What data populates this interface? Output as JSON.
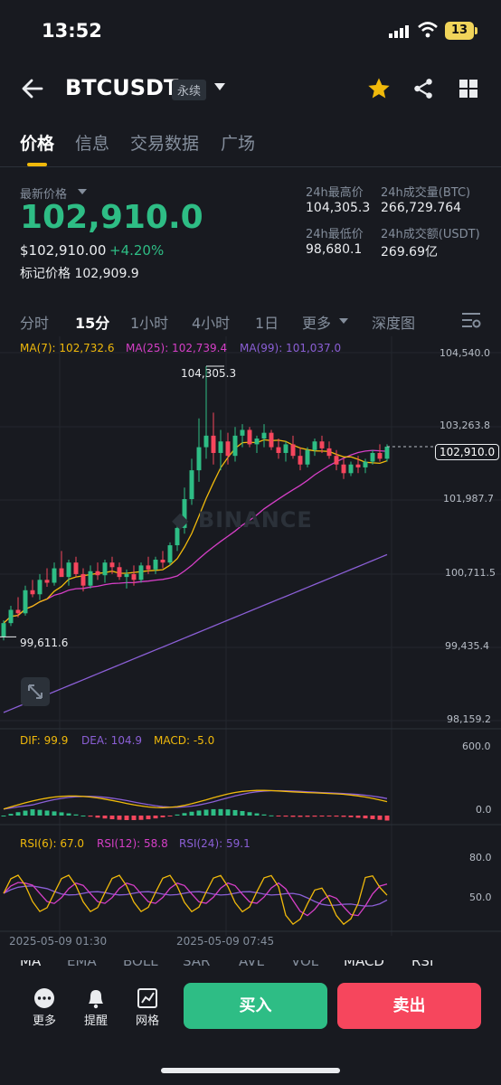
{
  "status_bar": {
    "time": "13:52",
    "battery": "13"
  },
  "header": {
    "symbol": "BTCUSDT",
    "contract_type": "永续"
  },
  "tabs": [
    "价格",
    "信息",
    "交易数据",
    "广场"
  ],
  "price": {
    "label": "最新价格",
    "last": "102,910.0",
    "usd": "$102,910.00",
    "change": "+4.20%",
    "mark_label": "标记价格",
    "mark": "102,909.9"
  },
  "stats": {
    "high_label": "24h最高价",
    "high": "104,305.3",
    "low_label": "24h最低价",
    "low": "98,680.1",
    "vol_btc_label": "24h成交量(BTC)",
    "vol_btc": "266,729.764",
    "vol_usdt_label": "24h成交额(USDT)",
    "vol_usdt": "269.69亿"
  },
  "intervals": [
    "分时",
    "15分",
    "1小时",
    "4小时",
    "1日",
    "更多",
    "深度图"
  ],
  "active_interval": "15分",
  "ma_legend": {
    "ma7": "MA(7): 102,732.6",
    "ma25": "MA(25): 102,739.4",
    "ma99": "MA(99): 101,037.0"
  },
  "watermark": "BINANCE",
  "price_axis": [
    "104,540.0",
    "103,263.8",
    "101,987.7",
    "100,711.5",
    "99,435.4",
    "98,159.2"
  ],
  "current_price_tag": "102,910.0",
  "high_marker": "104,305.3",
  "low_marker": "99,611.6",
  "macd_legend": {
    "dif": "DIF: 99.9",
    "dea": "DEA: 104.9",
    "macd": "MACD: -5.0"
  },
  "macd_axis": [
    "600.0",
    "0.0"
  ],
  "rsi_legend": {
    "rsi6": "RSI(6): 67.0",
    "rsi12": "RSI(12): 58.8",
    "rsi24": "RSI(24): 59.1"
  },
  "rsi_axis": [
    "80.0",
    "50.0"
  ],
  "dates": [
    "2025-05-09 01:30",
    "2025-05-09 07:45"
  ],
  "indicator_tabs": [
    "MA",
    "EMA",
    "BOLL",
    "SAR",
    "AVL",
    "VOL",
    "MACD",
    "RSI"
  ],
  "bottom": {
    "more": "更多",
    "alert": "提醒",
    "grid": "网格",
    "buy": "买入",
    "sell": "卖出"
  },
  "colors": {
    "up": "#2ebd85",
    "down": "#f6465d",
    "ma7": "#f0b90b",
    "ma25": "#d63fc7",
    "ma99": "#8b5fd6",
    "accent": "#f0b90b"
  },
  "chart_data": {
    "type": "candlestick",
    "interval": "15m",
    "y_range": [
      98159.2,
      104540.0
    ],
    "candles": [
      [
        99612,
        99900,
        99550,
        99850
      ],
      [
        99850,
        100150,
        99800,
        100080
      ],
      [
        100080,
        100300,
        99950,
        100020
      ],
      [
        100020,
        100500,
        99980,
        100420
      ],
      [
        100420,
        100600,
        100300,
        100350
      ],
      [
        100350,
        100700,
        100250,
        100600
      ],
      [
        100600,
        100800,
        100480,
        100550
      ],
      [
        100550,
        100900,
        100500,
        100800
      ],
      [
        100800,
        101100,
        100700,
        100650
      ],
      [
        100650,
        100950,
        100500,
        100900
      ],
      [
        100900,
        101000,
        100650,
        100700
      ],
      [
        100700,
        100800,
        100400,
        100500
      ],
      [
        100500,
        100850,
        100450,
        100750
      ],
      [
        100750,
        100900,
        100600,
        100680
      ],
      [
        100680,
        100950,
        100550,
        100900
      ],
      [
        100900,
        101000,
        100700,
        100820
      ],
      [
        100820,
        100900,
        100600,
        100650
      ],
      [
        100650,
        100780,
        100450,
        100700
      ],
      [
        100700,
        100850,
        100500,
        100600
      ],
      [
        100600,
        100900,
        100550,
        100850
      ],
      [
        100850,
        101000,
        100700,
        100780
      ],
      [
        100780,
        101000,
        100700,
        100950
      ],
      [
        100950,
        101100,
        100800,
        100900
      ],
      [
        100900,
        101250,
        100850,
        101200
      ],
      [
        101200,
        101600,
        101100,
        101500
      ],
      [
        101500,
        102200,
        101400,
        102000
      ],
      [
        102000,
        102700,
        101900,
        102500
      ],
      [
        102500,
        103400,
        102300,
        102900
      ],
      [
        102900,
        104305,
        102700,
        103100
      ],
      [
        103100,
        103500,
        102600,
        102800
      ],
      [
        102800,
        103200,
        102500,
        103000
      ],
      [
        103000,
        103150,
        102600,
        102750
      ],
      [
        102750,
        103250,
        102650,
        103100
      ],
      [
        103100,
        103300,
        102900,
        103200
      ],
      [
        103200,
        103250,
        102900,
        102950
      ],
      [
        102950,
        103100,
        102800,
        103050
      ],
      [
        103050,
        103300,
        102900,
        103150
      ],
      [
        103150,
        103200,
        102850,
        102900
      ],
      [
        102900,
        103050,
        102700,
        102800
      ],
      [
        102800,
        103000,
        102650,
        102950
      ],
      [
        102950,
        103100,
        102700,
        102750
      ],
      [
        102750,
        102900,
        102500,
        102600
      ],
      [
        102600,
        102900,
        102550,
        102850
      ],
      [
        102850,
        103050,
        102750,
        103000
      ],
      [
        103000,
        103100,
        102800,
        102880
      ],
      [
        102880,
        103000,
        102700,
        102750
      ],
      [
        102750,
        102850,
        102500,
        102600
      ],
      [
        102600,
        102700,
        102350,
        102450
      ],
      [
        102450,
        102650,
        102400,
        102600
      ],
      [
        102600,
        102750,
        102450,
        102550
      ],
      [
        102550,
        102700,
        102450,
        102650
      ],
      [
        102650,
        102850,
        102600,
        102800
      ],
      [
        102800,
        102950,
        102650,
        102700
      ],
      [
        102700,
        102950,
        102650,
        102910
      ]
    ]
  }
}
